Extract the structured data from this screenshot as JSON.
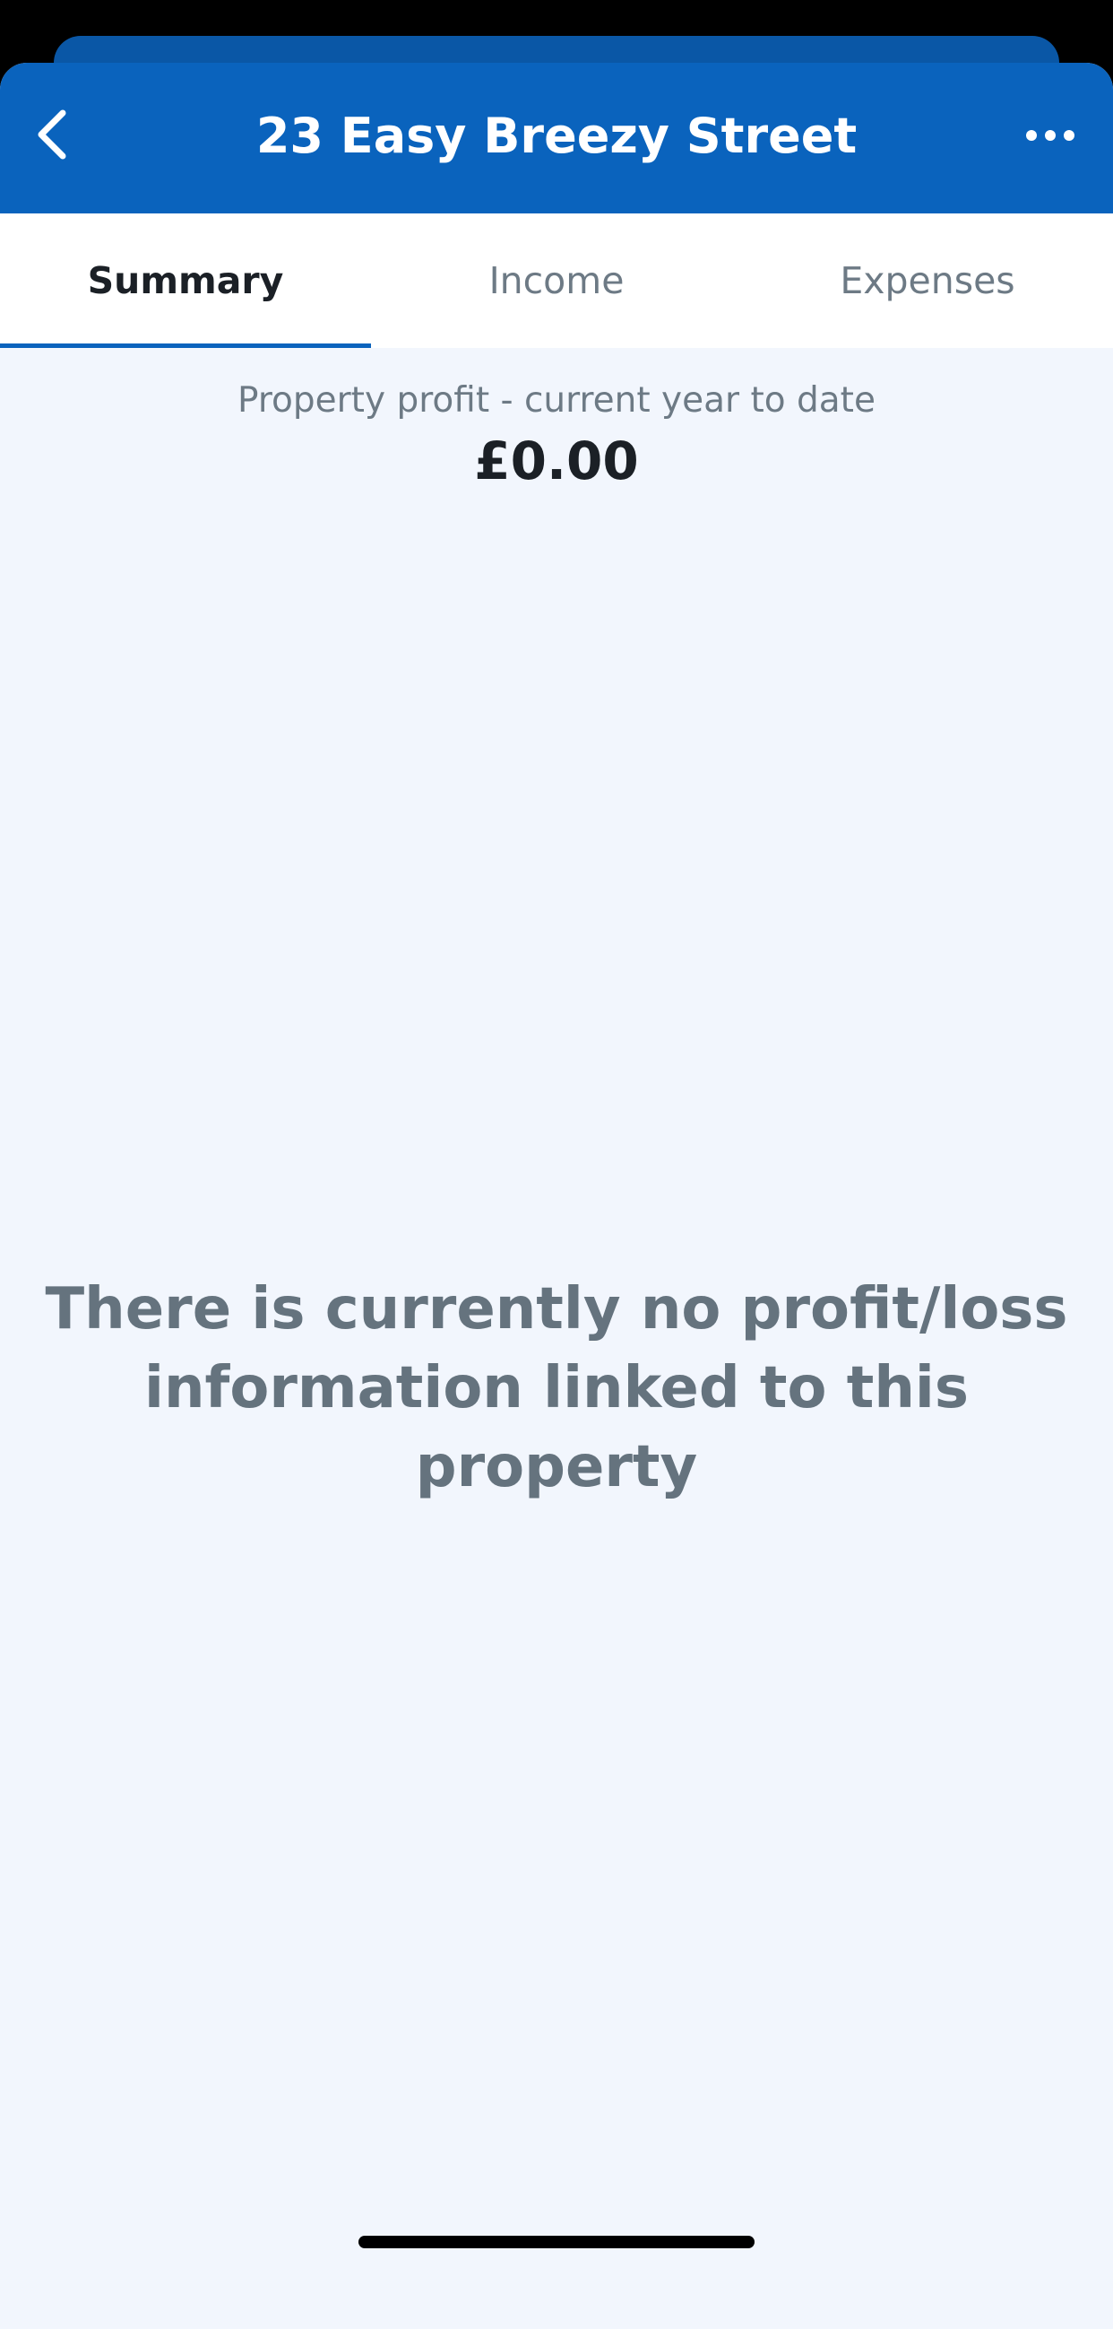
{
  "header": {
    "title": "23 Easy Breezy Street",
    "back_icon": "chevron-left-icon",
    "more_icon": "ellipsis-icon"
  },
  "tabs": [
    {
      "label": "Summary",
      "active": true
    },
    {
      "label": "Income",
      "active": false
    },
    {
      "label": "Expenses",
      "active": false
    }
  ],
  "summary": {
    "profit_label": "Property profit - current year to date",
    "profit_value": "£0.00",
    "empty_message": "There is currently no profit/loss information linked to this property"
  },
  "colors": {
    "header_bg": "#0a63bd",
    "content_bg": "#f2f6fd",
    "active_tab_indicator": "#0a63bd"
  }
}
